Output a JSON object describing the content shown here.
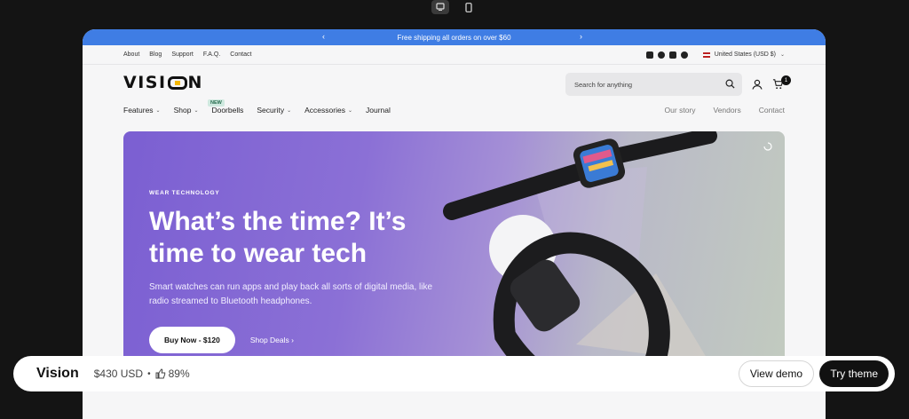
{
  "device_toggle": {
    "desktop_icon": "desktop-icon",
    "mobile_icon": "mobile-icon",
    "active": "desktop"
  },
  "announcement": {
    "text": "Free shipping all orders on over $60",
    "prev": "‹",
    "next": "›"
  },
  "utility": {
    "links": [
      "About",
      "Blog",
      "Support",
      "F.A.Q.",
      "Contact"
    ],
    "social_icons": [
      "facebook-icon",
      "x-icon",
      "instagram-icon",
      "tiktok-icon"
    ],
    "locale": "United States (USD $)"
  },
  "header": {
    "logo": {
      "before": "VISI",
      "after": "N"
    },
    "search_placeholder": "Search for anything",
    "cart_count": "1"
  },
  "nav": {
    "left": [
      {
        "label": "Features",
        "dropdown": true
      },
      {
        "label": "Shop",
        "dropdown": true,
        "badge": "NEW"
      },
      {
        "label": "Doorbells",
        "dropdown": false
      },
      {
        "label": "Security",
        "dropdown": true
      },
      {
        "label": "Accessories",
        "dropdown": true
      },
      {
        "label": "Journal",
        "dropdown": false
      }
    ],
    "right": [
      "Our story",
      "Vendors",
      "Contact"
    ]
  },
  "hero": {
    "eyebrow": "WEAR TECHNOLOGY",
    "headline": "What’s the time? It’s time to wear tech",
    "subtext": "Smart watches can run apps and play back all sorts of digital media, like radio streamed to Bluetooth headphones.",
    "cta_primary": "Buy Now - $120",
    "cta_secondary": "Shop Deals",
    "cta_secondary_arrow": "›"
  },
  "bottom_bar": {
    "theme_name": "Vision",
    "price": "$430 USD",
    "separator": "•",
    "rating": "89%",
    "view_demo": "View demo",
    "try_theme": "Try theme"
  },
  "colors": {
    "announcement_bg": "#3f7de4",
    "hero_purple": "#7b5fd2",
    "dark": "#111111",
    "new_badge": "#cfe9df"
  }
}
